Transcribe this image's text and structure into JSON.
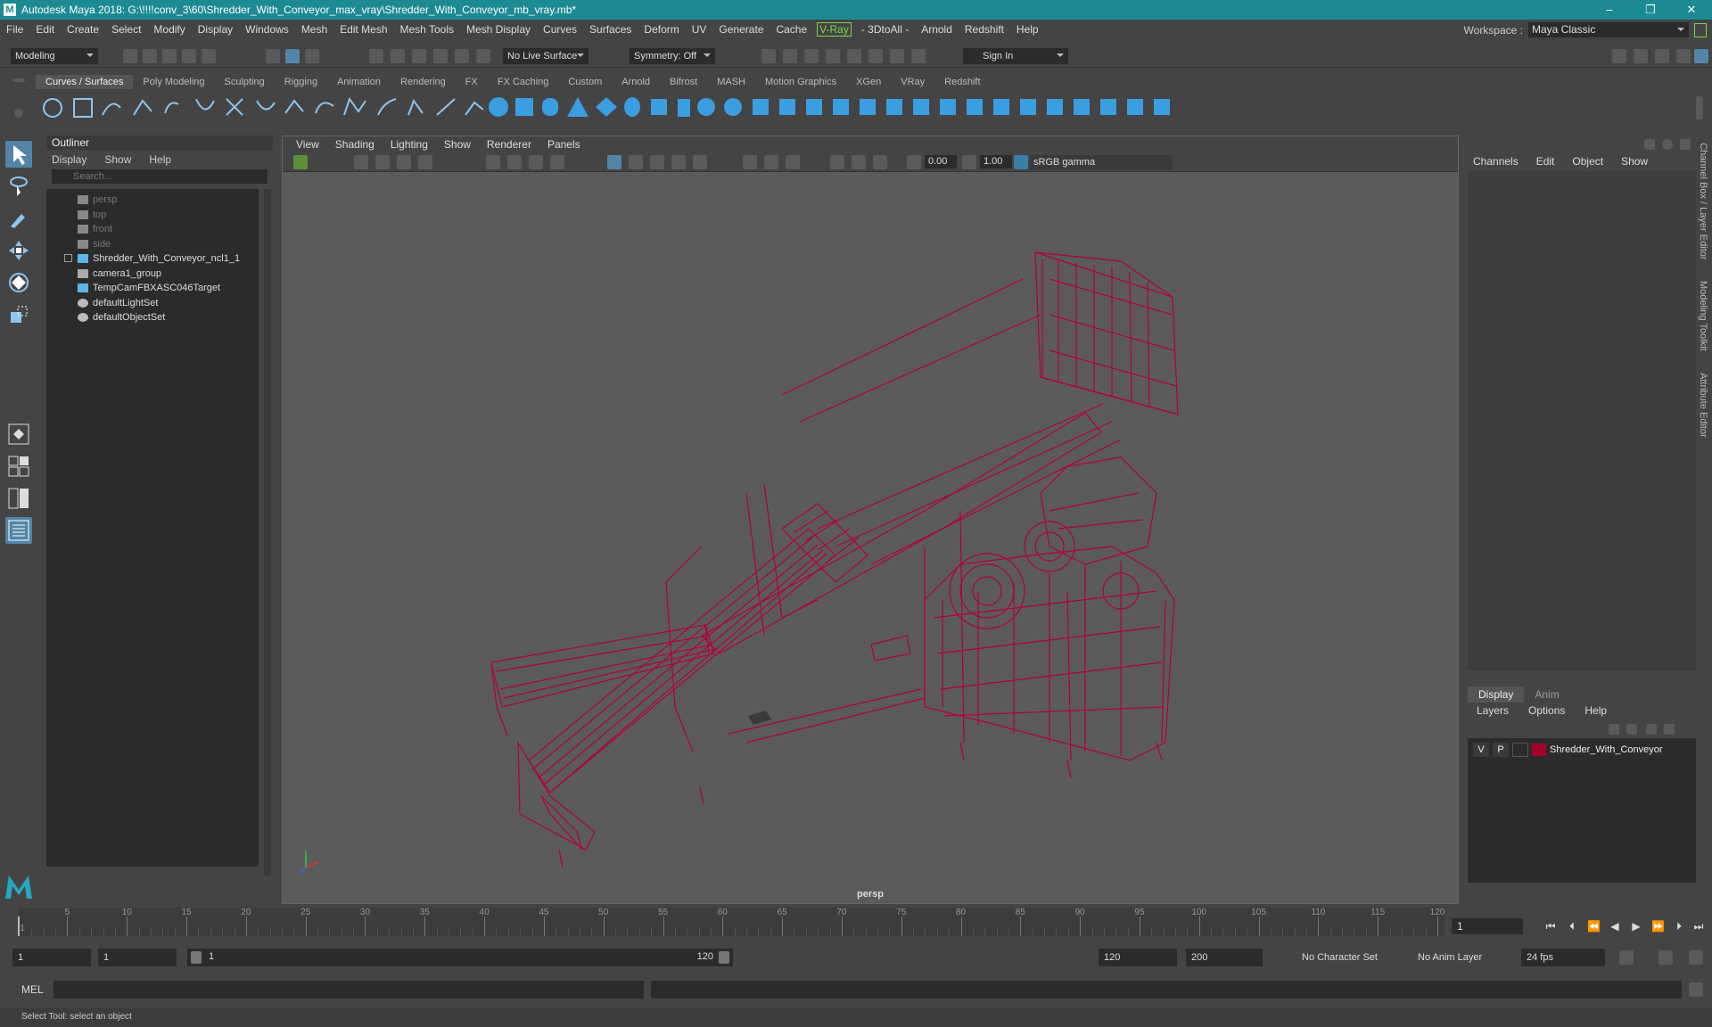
{
  "title": {
    "text": "Autodesk Maya 2018: G:\\!!!!conv_3\\60\\Shredder_With_Conveyor_max_vray\\Shredder_With_Conveyor_mb_vray.mb*",
    "logo": "M"
  },
  "window_controls": {
    "minimize": "–",
    "maximize": "❐",
    "close": "✕"
  },
  "menus": [
    "File",
    "Edit",
    "Create",
    "Select",
    "Modify",
    "Display",
    "Windows",
    "Mesh",
    "Edit Mesh",
    "Mesh Tools",
    "Mesh Display",
    "Curves",
    "Surfaces",
    "Deform",
    "UV",
    "Generate",
    "Cache",
    "V-Ray",
    "- 3DtoAll -",
    "Arnold",
    "Redshift",
    "Help"
  ],
  "workspace": {
    "label": "Workspace :",
    "value": "Maya Classic"
  },
  "status": {
    "mode": "Modeling",
    "live_surface": "No Live Surface",
    "symmetry": "Symmetry: Off",
    "sign_in": "Sign In"
  },
  "shelf_tabs": [
    "Curves / Surfaces",
    "Poly Modeling",
    "Sculpting",
    "Rigging",
    "Animation",
    "Rendering",
    "FX",
    "FX Caching",
    "Custom",
    "Arnold",
    "Bifrost",
    "MASH",
    "Motion Graphics",
    "XGen",
    "VRay",
    "Redshift"
  ],
  "shelf_active": "Curves / Surfaces",
  "outliner": {
    "title": "Outliner",
    "menu": [
      "Display",
      "Show",
      "Help"
    ],
    "search_placeholder": "Search...",
    "items": [
      {
        "label": "persp",
        "icon": "camera-icon",
        "dim": true
      },
      {
        "label": "top",
        "icon": "camera-icon",
        "dim": true
      },
      {
        "label": "front",
        "icon": "camera-icon",
        "dim": true
      },
      {
        "label": "side",
        "icon": "camera-icon",
        "dim": true
      },
      {
        "label": "Shredder_With_Conveyor_ncl1_1",
        "icon": "transform-icon",
        "expand": true
      },
      {
        "label": "camera1_group",
        "icon": "group-icon"
      },
      {
        "label": "TempCamFBXASC046Target",
        "icon": "transform-icon"
      },
      {
        "label": "defaultLightSet",
        "icon": "set-icon"
      },
      {
        "label": "defaultObjectSet",
        "icon": "set-icon"
      }
    ]
  },
  "viewport": {
    "menu": [
      "View",
      "Shading",
      "Lighting",
      "Show",
      "Renderer",
      "Panels"
    ],
    "exposure": "0.00",
    "gamma": "1.00",
    "color_space": "sRGB gamma",
    "camera_label": "persp",
    "wire_color": "#b3003a"
  },
  "channel_box": {
    "menu": [
      "Channels",
      "Edit",
      "Object",
      "Show"
    ]
  },
  "layer_editor": {
    "tabs": [
      "Display",
      "Anim"
    ],
    "menu": [
      "Layers",
      "Options",
      "Help"
    ],
    "layer": {
      "v": "V",
      "p": "P",
      "name": "Shredder_With_Conveyor",
      "color": "#a3002c"
    }
  },
  "side_tabs": [
    "Channel Box / Layer Editor",
    "Modeling Toolkit",
    "Attribute Editor"
  ],
  "timeline": {
    "ticks": [
      "5",
      "10",
      "15",
      "20",
      "25",
      "30",
      "35",
      "40",
      "45",
      "50",
      "55",
      "60",
      "65",
      "70",
      "75",
      "80",
      "85",
      "90",
      "95",
      "100",
      "105",
      "110",
      "115",
      "120"
    ],
    "start_marker": "1",
    "current_frame": "1"
  },
  "range": {
    "start": "1",
    "playback_start": "1",
    "slider_start": "1",
    "slider_end": "120",
    "playback_end": "120",
    "end": "200",
    "character_set": "No Character Set",
    "anim_layer": "No Anim Layer",
    "fps": "24 fps"
  },
  "command": {
    "label": "MEL"
  },
  "help_line": "Select Tool: select an object"
}
